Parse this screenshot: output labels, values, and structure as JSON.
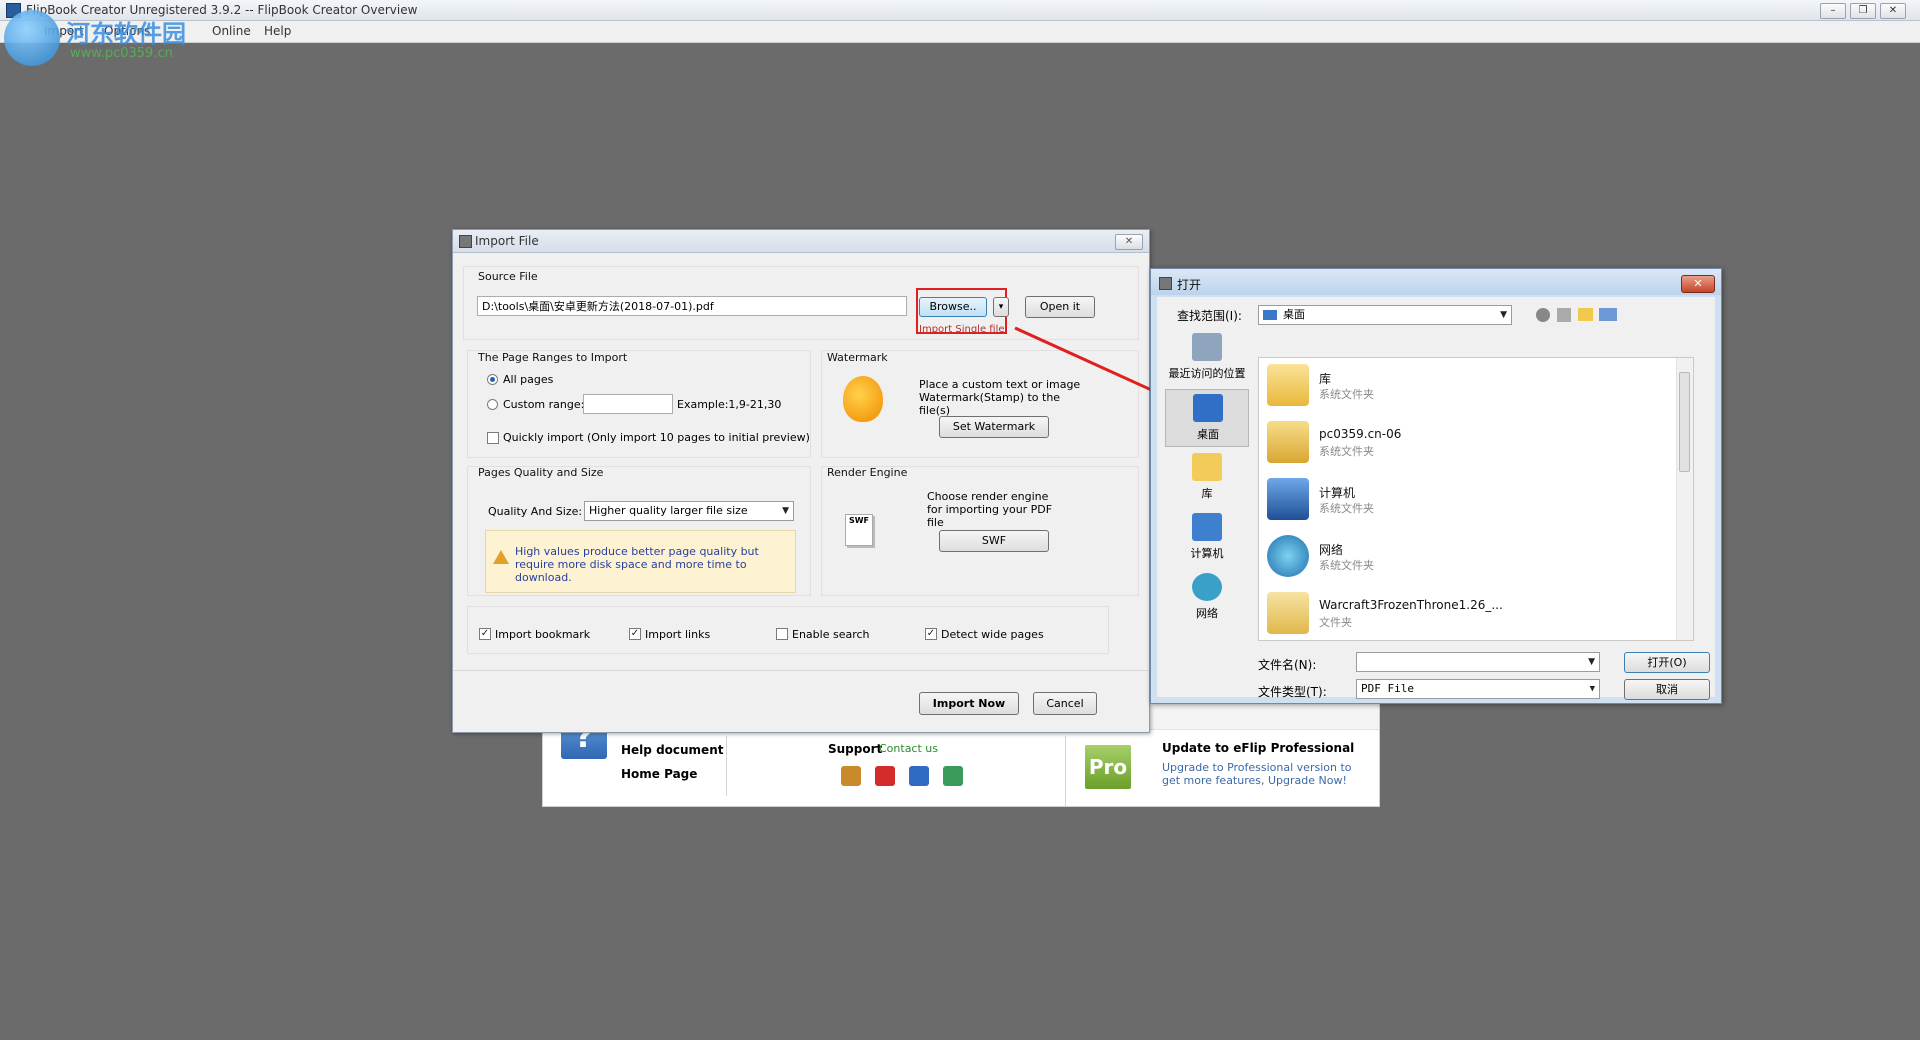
{
  "app": {
    "title": "FlipBook Creator Unregistered 3.9.2  -- FlipBook Creator Overview",
    "menus": [
      "Import",
      "Options",
      "Online",
      "Help"
    ],
    "window_controls": {
      "minimize": "–",
      "maximize": "❐",
      "close": "✕"
    },
    "watermark": {
      "name": "河东软件园",
      "url": "www.pc0359.cn"
    }
  },
  "import_dialog": {
    "title": "Import File",
    "close": "✕",
    "source_file": {
      "label": "Source File",
      "path": "D:\\tools\\桌面\\安卓更新方法(2018-07-01).pdf",
      "browse": "Browse..",
      "dropdown": "▾",
      "open_it": "Open it",
      "hint": "Import Single file"
    },
    "page_ranges": {
      "label": "The Page Ranges to Import",
      "all_pages": "All pages",
      "custom_range": "Custom range:",
      "custom_value": "",
      "example": "Example:1,9-21,30",
      "quick_import": "Quickly import (Only import 10 pages to  initial  preview)"
    },
    "watermark": {
      "label": "Watermark",
      "desc": "Place a custom text or image Watermark(Stamp) to the file(s)",
      "button": "Set Watermark"
    },
    "quality": {
      "label": "Pages Quality and Size",
      "field_label": "Quality And Size:",
      "selected": "Higher quality larger file size",
      "note": "High values produce better page quality but require more disk space and more time to download."
    },
    "render_engine": {
      "label": "Render Engine",
      "desc": "Choose render engine for importing your PDF file",
      "button": "SWF"
    },
    "options": {
      "import_bookmark": "Import bookmark",
      "import_links": "Import links",
      "enable_search": "Enable search",
      "detect_wide": "Detect wide pages"
    },
    "import_now": "Import Now",
    "cancel": "Cancel"
  },
  "open_dialog": {
    "title": "打开",
    "close": "✕",
    "look_in_label": "查找范围(I):",
    "look_in_value": "桌面",
    "places": [
      "最近访问的位置",
      "桌面",
      "库",
      "计算机",
      "网络"
    ],
    "files": [
      {
        "name": "库",
        "type": "系统文件夹"
      },
      {
        "name": "pc0359.cn-06",
        "type": "系统文件夹"
      },
      {
        "name": "计算机",
        "type": "系统文件夹"
      },
      {
        "name": "网络",
        "type": "系统文件夹"
      },
      {
        "name": "Warcraft3FrozenThrone1.26_...",
        "type": "文件夹"
      }
    ],
    "filename_label": "文件名(N):",
    "filename_value": "",
    "filetype_label": "文件类型(T):",
    "filetype_value": "PDF File",
    "open_button": "打开(O)",
    "cancel_button": "取消"
  },
  "welcome": {
    "help_document": "Help document",
    "home_page": "Home Page",
    "support": "Support",
    "contact": "Contact us",
    "pro_badge": "Pro",
    "upgrade_title": "Update to eFlip Professional",
    "upgrade_desc": "Upgrade to Professional version to get more features, Upgrade Now!"
  },
  "colors": {
    "desktop": "#6b6b6b",
    "annotation_red": "#e02020"
  }
}
